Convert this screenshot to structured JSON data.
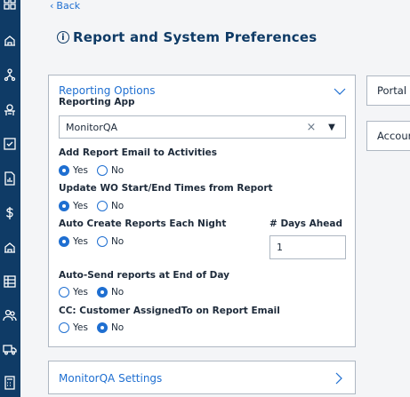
{
  "nav": {
    "back_label": "Back"
  },
  "page": {
    "title": "Report and System Preferences"
  },
  "reporting_options": {
    "header": "Reporting Options",
    "reporting_app_label": "Reporting App",
    "reporting_app_value": "MonitorQA",
    "add_report_email_label": "Add Report Email to Activities",
    "add_report_email_value": "Yes",
    "update_wo_label": "Update WO Start/End Times from Report",
    "update_wo_value": "Yes",
    "auto_create_label": "Auto Create Reports Each Night",
    "auto_create_value": "Yes",
    "days_ahead_label": "# Days Ahead",
    "days_ahead_value": "1",
    "auto_send_label": "Auto-Send reports at End of Day",
    "auto_send_value": "No",
    "cc_label": "CC: Customer AssignedTo on Report Email",
    "cc_value": "No",
    "yes_label": "Yes",
    "no_label": "No"
  },
  "monitorqa_settings": {
    "label": "MonitorQA Settings"
  },
  "side_cards": {
    "portal": "Portal",
    "account": "Accoun"
  },
  "colors": {
    "sidebar": "#0f3b66",
    "accent": "#1f6fd1",
    "title": "#0f3b66"
  }
}
